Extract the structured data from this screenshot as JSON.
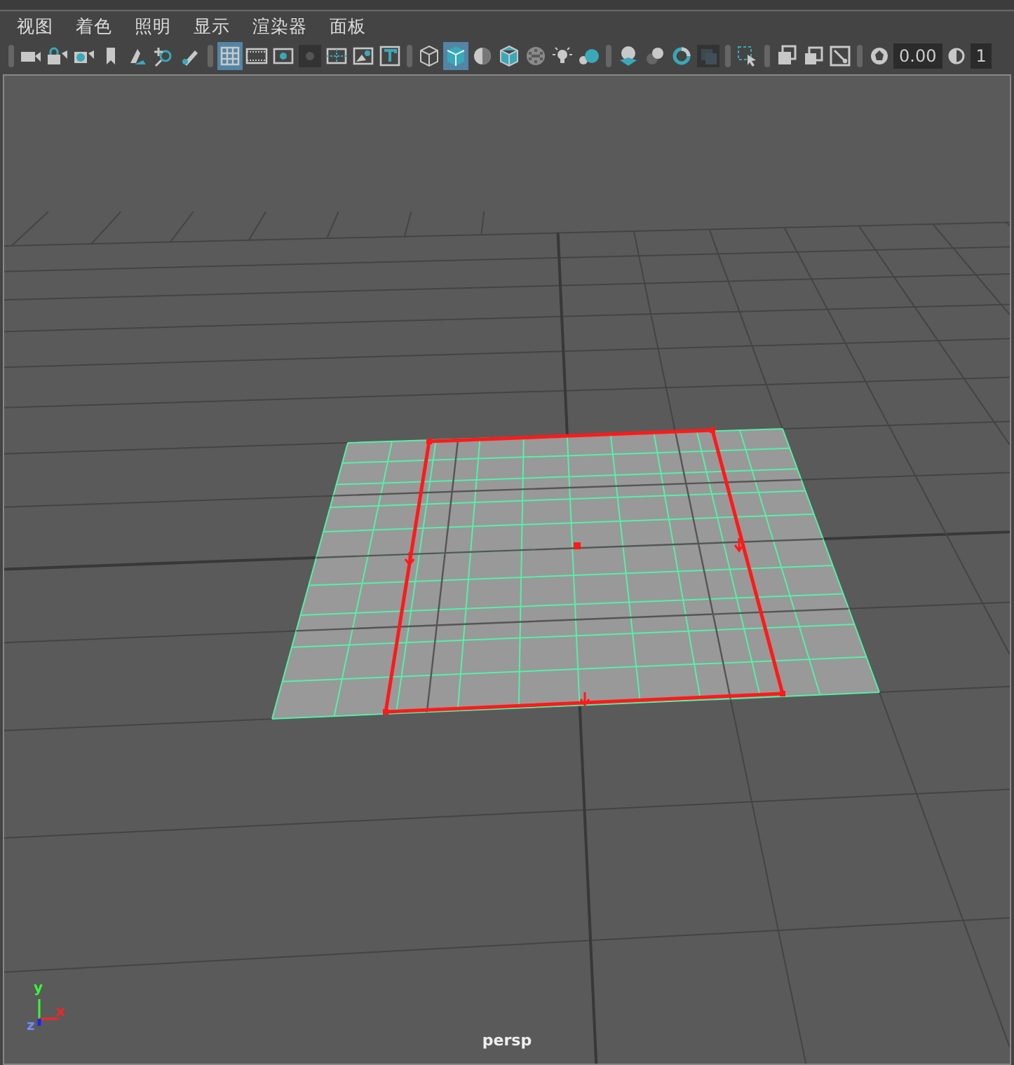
{
  "menu": [
    {
      "label": "视图"
    },
    {
      "label": "着色"
    },
    {
      "label": "照明"
    },
    {
      "label": "显示"
    },
    {
      "label": "渲染器"
    },
    {
      "label": "面板"
    }
  ],
  "toolbar": [
    {
      "kind": "separator"
    },
    {
      "kind": "button",
      "selected": false
    },
    {
      "kind": "button",
      "selected": false
    },
    {
      "kind": "button",
      "selected": false
    },
    {
      "kind": "button",
      "selected": false
    },
    {
      "kind": "button",
      "selected": false
    },
    {
      "kind": "button",
      "selected": false
    },
    {
      "kind": "button",
      "selected": false
    },
    {
      "kind": "separator"
    },
    {
      "kind": "button",
      "selected": true
    },
    {
      "kind": "button",
      "selected": false
    },
    {
      "kind": "button",
      "selected": false
    },
    {
      "kind": "button",
      "selected": false
    },
    {
      "kind": "button",
      "selected": false
    },
    {
      "kind": "button",
      "selected": false
    },
    {
      "kind": "button",
      "selected": false
    },
    {
      "kind": "separator"
    },
    {
      "kind": "button",
      "selected": false
    },
    {
      "kind": "button",
      "selected": true
    },
    {
      "kind": "button",
      "selected": false
    },
    {
      "kind": "button",
      "selected": false
    },
    {
      "kind": "button",
      "selected": false
    },
    {
      "kind": "button",
      "selected": false
    },
    {
      "kind": "button",
      "selected": false
    },
    {
      "kind": "separator"
    },
    {
      "kind": "button",
      "selected": false
    },
    {
      "kind": "button",
      "selected": false
    },
    {
      "kind": "button",
      "selected": false
    },
    {
      "kind": "button",
      "selected": false
    },
    {
      "kind": "separator"
    },
    {
      "kind": "button",
      "selected": false
    },
    {
      "kind": "separator"
    },
    {
      "kind": "button",
      "selected": false
    },
    {
      "kind": "button",
      "selected": false
    },
    {
      "kind": "button",
      "selected": false
    },
    {
      "kind": "separator"
    },
    {
      "kind": "button",
      "selected": false
    },
    {
      "kind": "field",
      "value": "0.00"
    },
    {
      "kind": "button",
      "selected": false
    },
    {
      "kind": "field",
      "value": "1"
    }
  ],
  "viewport": {
    "axis_labels": [
      "y",
      "x",
      "z"
    ],
    "camera_label": "persp"
  }
}
